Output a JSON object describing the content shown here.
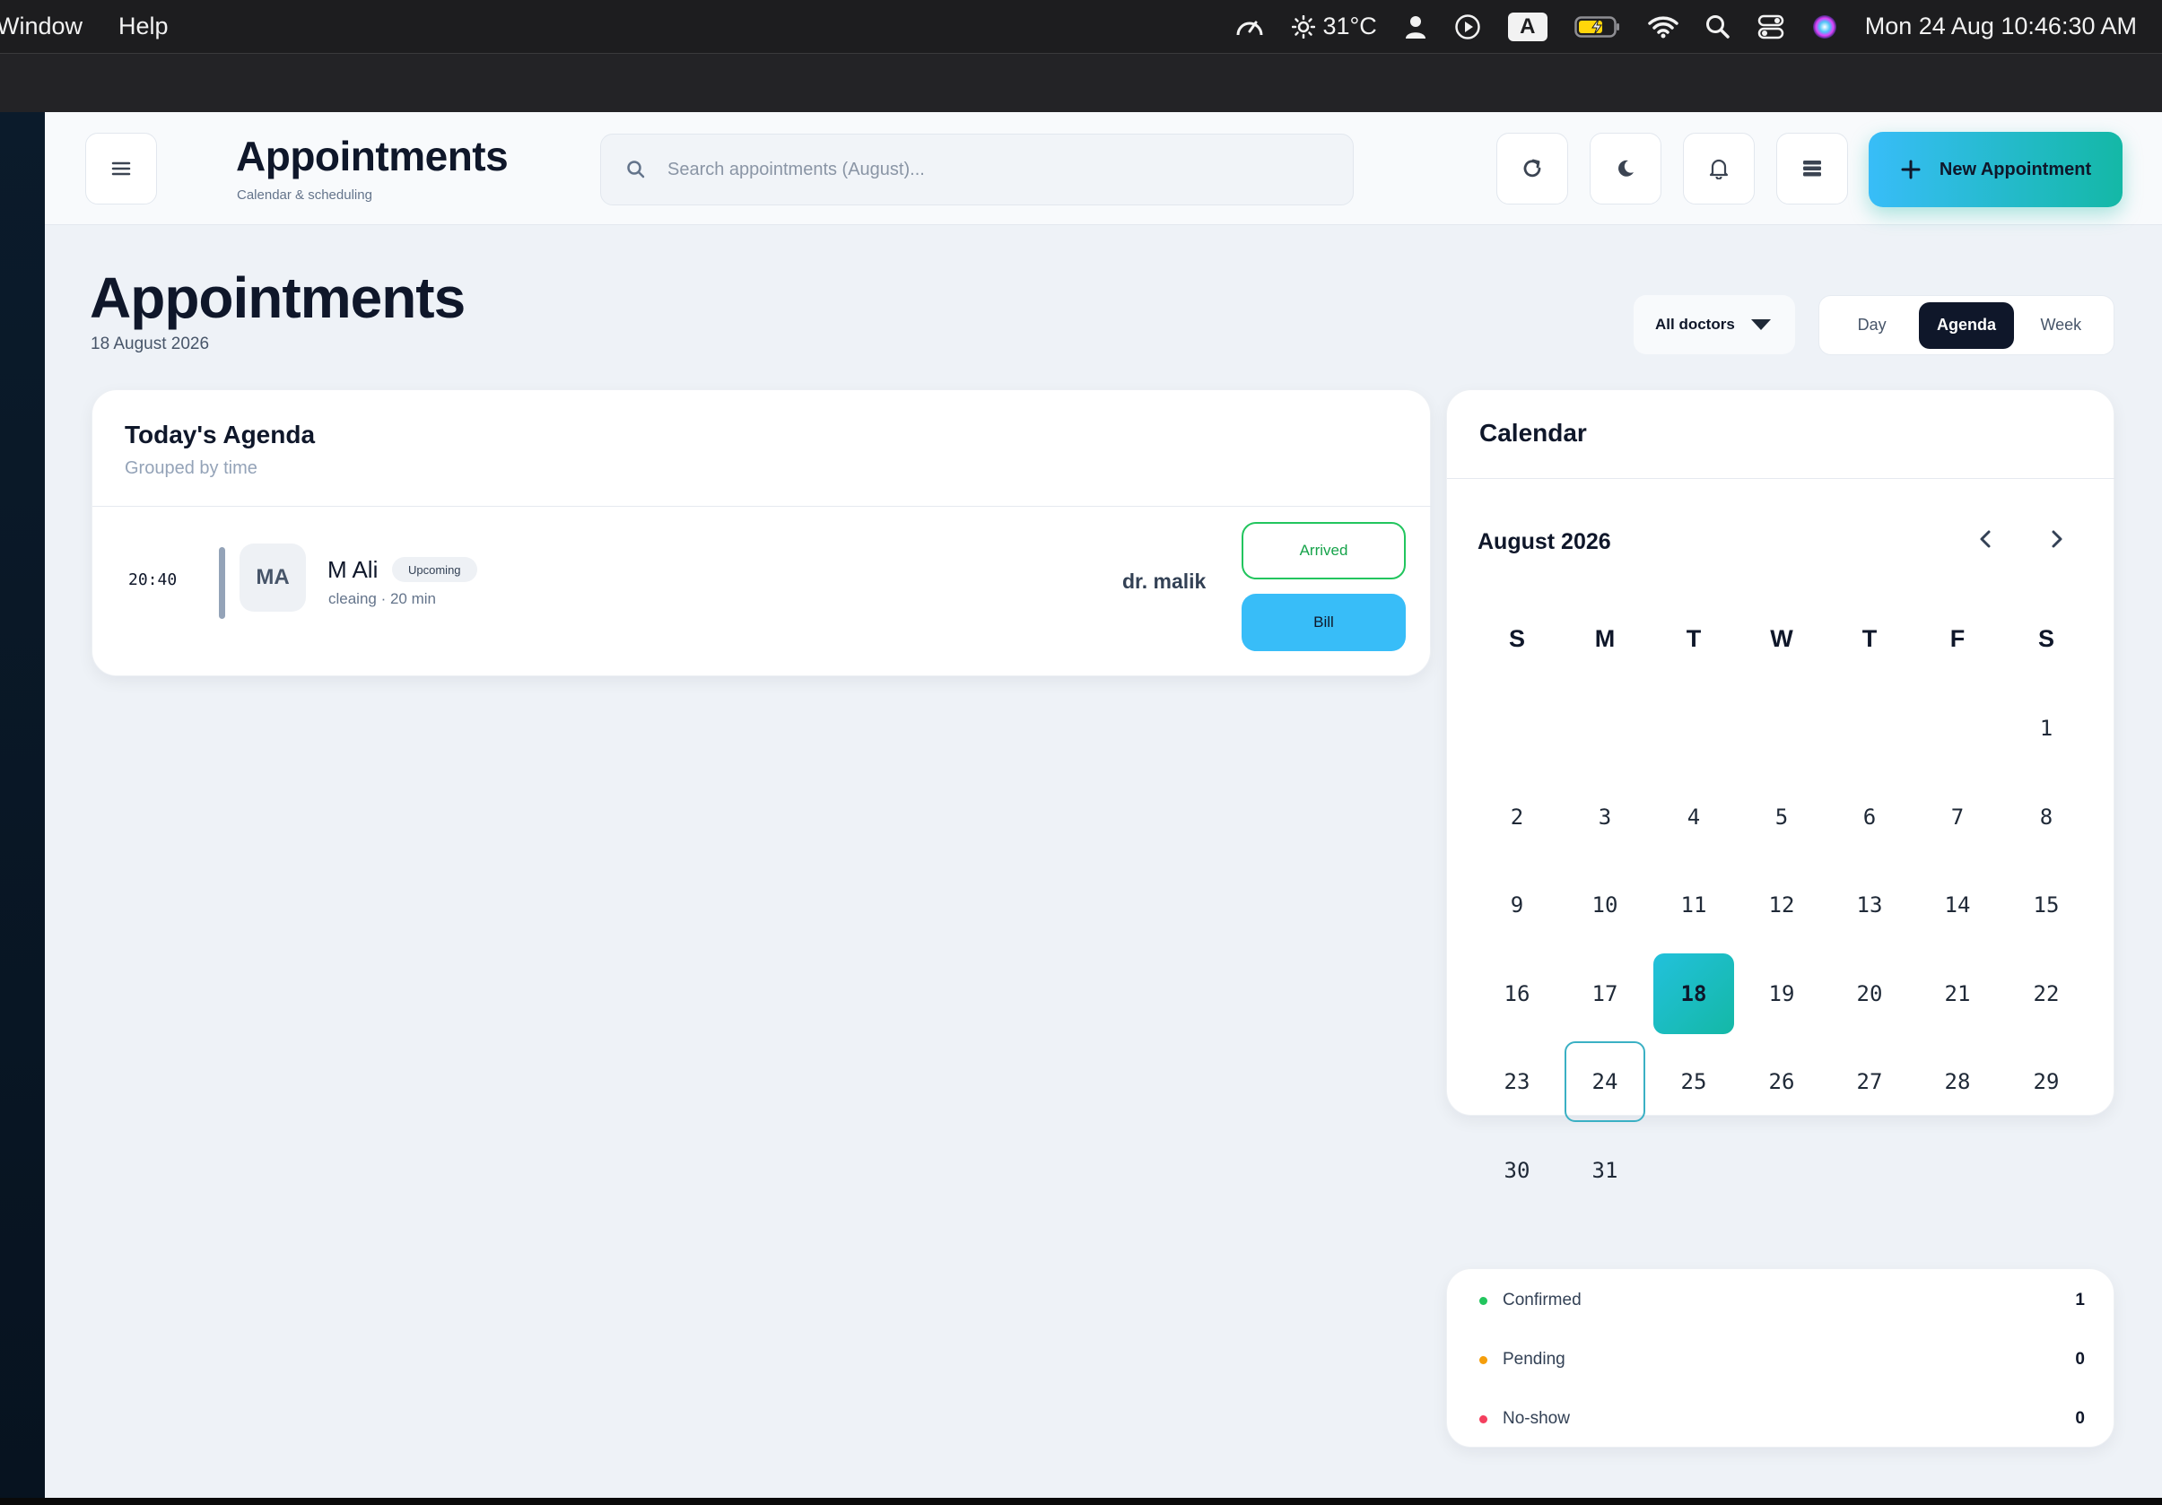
{
  "menubar": {
    "items": [
      "Window",
      "Help"
    ],
    "weather": "31°C",
    "input_source": "A",
    "clock": "Mon 24 Aug  10:46:30 AM"
  },
  "topbar": {
    "title": "Appointments",
    "subtitle": "Calendar & scheduling",
    "search_placeholder": "Search appointments (August)...",
    "new_button_label": "New Appointment",
    "icons": [
      "menu-icon",
      "refresh-icon",
      "moon-icon",
      "bell-icon",
      "list-icon",
      "plus-icon"
    ]
  },
  "header": {
    "title": "Appointments",
    "date": "18 August 2026",
    "doctor_filter": "All doctors",
    "views": [
      "Day",
      "Agenda",
      "Week"
    ],
    "active_view": "Agenda"
  },
  "agenda": {
    "title": "Today's Agenda",
    "subtitle": "Grouped by time",
    "appointments": [
      {
        "time": "20:40",
        "initials": "MA",
        "patient": "M Ali",
        "status": "Upcoming",
        "meta": "cleaing · 20 min",
        "doctor": "dr. malik",
        "arrived_label": "Arrived",
        "bill_label": "Bill"
      }
    ]
  },
  "calendar": {
    "title": "Calendar",
    "month_label": "August 2026",
    "weekdays": [
      "S",
      "M",
      "T",
      "W",
      "T",
      "F",
      "S"
    ],
    "first_weekday_index": 6,
    "days_in_month": 31,
    "selected_day": 18,
    "today_day": 24
  },
  "legend": [
    {
      "label": "Confirmed",
      "value": "1",
      "color": "#22c55e"
    },
    {
      "label": "Pending",
      "value": "0",
      "color": "#f59e0b"
    },
    {
      "label": "No-show",
      "value": "0",
      "color": "#f43f5e"
    }
  ],
  "colors": {
    "accent_start": "#38bdf8",
    "accent_end": "#14b8a6",
    "dark": "#0f172a"
  }
}
